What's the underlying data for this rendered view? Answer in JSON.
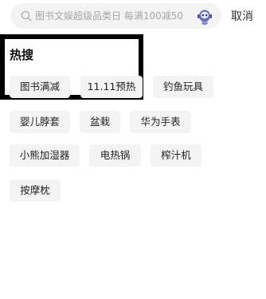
{
  "search": {
    "placeholder": "图书文娱超级品类日 每满100减50"
  },
  "topbar": {
    "cancel_label": "取消"
  },
  "hot": {
    "title": "热搜",
    "tags": [
      "图书满减",
      "11.11预热",
      "钓鱼玩具",
      "婴儿脖套",
      "盆栽",
      "华为手表",
      "小熊加湿器",
      "电热锅",
      "榨汁机",
      "按摩枕"
    ]
  }
}
